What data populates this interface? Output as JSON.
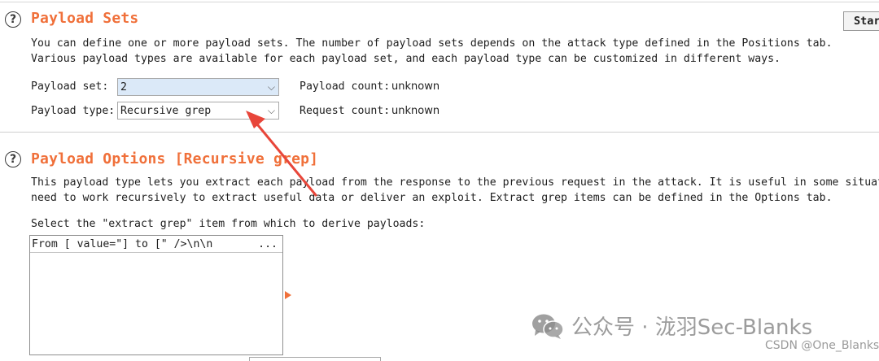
{
  "payload_sets": {
    "title": "Payload Sets",
    "description_line1": "You can define one or more payload sets. The number of payload sets depends on the attack type defined in the Positions tab.",
    "description_line2": "Various payload types are available for each payload set, and each payload type can be customized in different ways.",
    "payload_set_label": "Payload set:",
    "payload_set_value": "2",
    "payload_type_label": "Payload type:",
    "payload_type_value": "Recursive grep",
    "payload_count_label": "Payload count:",
    "payload_count_value": "unknown",
    "request_count_label": "Request count:",
    "request_count_value": "unknown"
  },
  "toolbar": {
    "start_attack_label": "Start attack"
  },
  "payload_options": {
    "title": "Payload Options [Recursive grep]",
    "description_line1": "This payload type lets you extract each payload from the response to the previous request in the attack. It is useful in some situations",
    "description_line2": "need to work recursively to extract useful data or deliver an exploit. Extract grep items can be defined in the Options tab.",
    "select_label": "Select the \"extract grep\" item from which to derive payloads:",
    "grep_items": [
      {
        "text": "From [ value=\"] to [\" />\\n\\n",
        "more": "..."
      }
    ]
  },
  "watermark": {
    "main": "公众号 · 泷羽Sec-Blanks",
    "sub": "CSDN @One_Blanks"
  },
  "colors": {
    "title_accent": "#f0703a",
    "annotation_arrow": "#e8463a",
    "selected_combo_bg": "#dbe9f8"
  },
  "icons": {
    "help": "help-icon",
    "dropdown": "chevron-down-icon",
    "wechat": "wechat-icon"
  }
}
